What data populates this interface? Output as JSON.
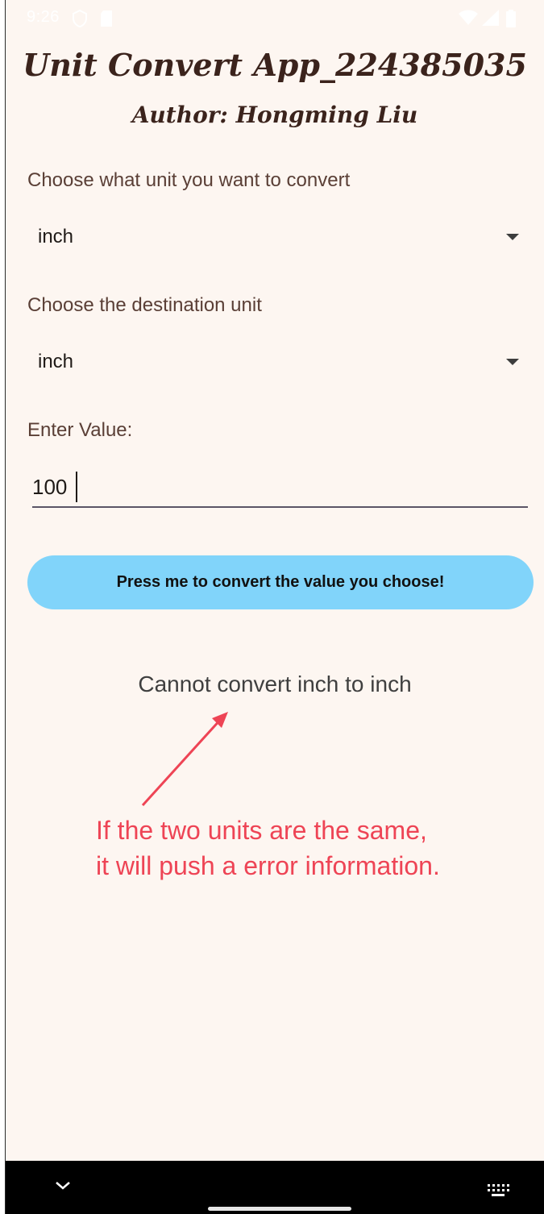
{
  "status_bar": {
    "time": "9:26",
    "icons": [
      "privacy-icon",
      "sim-card-icon",
      "wifi-icon",
      "signal-icon",
      "battery-icon"
    ]
  },
  "header": {
    "title": "Unit Convert App_224385035",
    "author": "Author: Hongming Liu"
  },
  "source_unit": {
    "label": "Choose what unit you want to convert",
    "selected": "inch"
  },
  "destination_unit": {
    "label": "Choose the destination unit",
    "selected": "inch"
  },
  "value_field": {
    "label": "Enter Value:",
    "value": "100"
  },
  "convert_button": {
    "label": "Press me to convert the value you choose!"
  },
  "result": {
    "message": "Cannot convert inch to inch"
  },
  "annotation": {
    "line1": "If the two units are the same,",
    "line2": "it will push a error information."
  },
  "colors": {
    "background": "#fdf6f1",
    "title": "#3b231c",
    "button": "#81d4fa",
    "annotation": "#ee4455"
  }
}
